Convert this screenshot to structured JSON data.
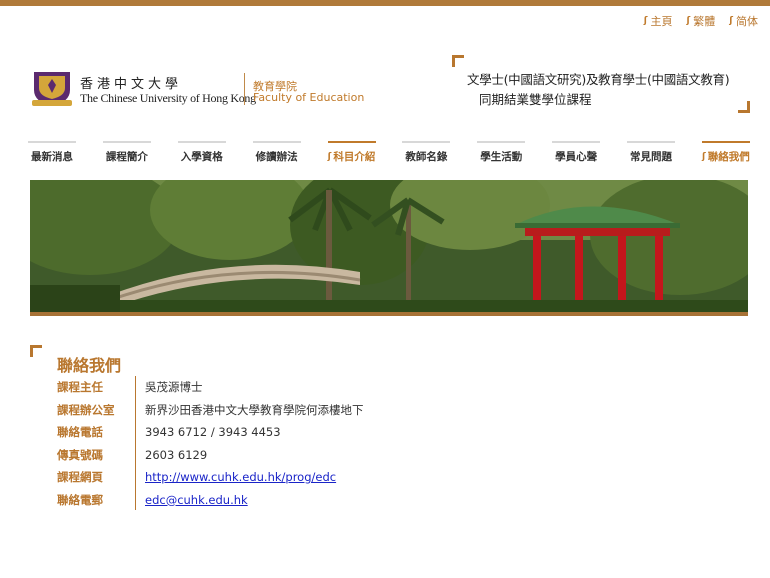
{
  "lang_links": [
    {
      "label": "主頁"
    },
    {
      "label": "繁體"
    },
    {
      "label": "简体"
    }
  ],
  "logo": {
    "university_cn": "香港中文大學",
    "university_en": "The Chinese University of Hong Kong",
    "faculty_cn": "教育學院",
    "faculty_en": "Faculty of Education"
  },
  "programme": {
    "line1": "文學士(中國語文研究)及教育學士(中國語文教育)",
    "line2": "同期結業雙學位課程"
  },
  "nav": [
    {
      "label": "最新消息"
    },
    {
      "label": "課程簡介"
    },
    {
      "label": "入學資格"
    },
    {
      "label": "修讀辦法"
    },
    {
      "label": "科目介紹"
    },
    {
      "label": "教師名錄"
    },
    {
      "label": "學生活動"
    },
    {
      "label": "學員心聲"
    },
    {
      "label": "常見問題"
    },
    {
      "label": "聯絡我們"
    }
  ],
  "contact": {
    "title": "聯絡我們",
    "rows": [
      {
        "label": "課程主任",
        "value": "吳茂源博士"
      },
      {
        "label": "課程辦公室",
        "value": "新界沙田香港中文大學教育學院何添樓地下"
      },
      {
        "label": "聯絡電話",
        "value": "3943 6712 / 3943 4453"
      },
      {
        "label": "傳真號碼",
        "value": "2603 6129"
      },
      {
        "label": "課程網頁",
        "value": "http://www.cuhk.edu.hk/prog/edc"
      },
      {
        "label": "聯絡電郵",
        "value": "edc@cuhk.edu.hk"
      }
    ]
  },
  "colors": {
    "accent": "#b9772f",
    "link": "#1a24c8"
  }
}
